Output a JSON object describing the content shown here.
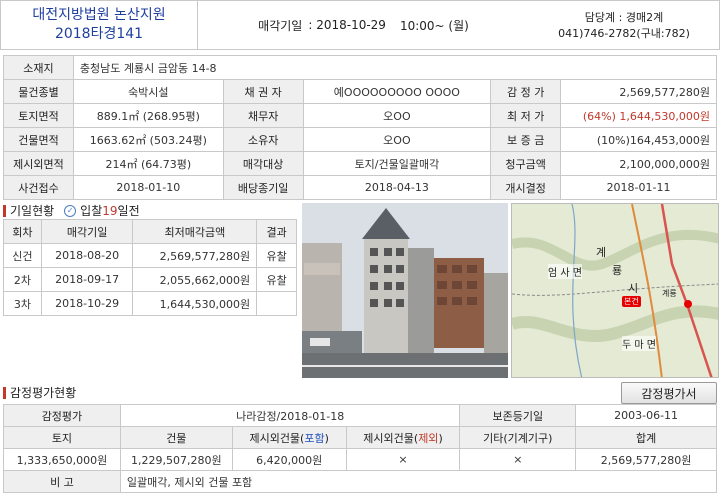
{
  "header": {
    "court": "대전지방법원 논산지원",
    "case_no": "2018타경141",
    "auction_label": "매각기일",
    "auction_date": ": 2018-10-29",
    "auction_time": "10:00~ (월)",
    "contact_dept": "담당계 : 경매2계",
    "contact_phone": "041)746-2782(구내:782)"
  },
  "info": {
    "address_label": "소재지",
    "address": "충청남도 계룡시 금암동 14-8",
    "rows": [
      [
        "물건종별",
        "숙박시설",
        "채 권 자",
        "예OOOOOOOOO OOOO",
        "감 정 가",
        "2,569,577,280원"
      ],
      [
        "토지면적",
        "889.1㎡ (268.95평)",
        "채무자",
        "오OO",
        "최 저 가",
        "(64%) 1,644,530,000원"
      ],
      [
        "건물면적",
        "1663.62㎡ (503.24평)",
        "소유자",
        "오OO",
        "보 증 금",
        "(10%)164,453,000원"
      ],
      [
        "제시외면적",
        "214㎡ (64.73평)",
        "매각대상",
        "토지/건물일괄매각",
        "청구금액",
        "2,100,000,000원"
      ],
      [
        "사건접수",
        "2018-01-10",
        "배당종기일",
        "2018-04-13",
        "개시결정",
        "2018-01-11"
      ]
    ]
  },
  "history": {
    "title": "기일현황",
    "badge_prefix": "입찰",
    "badge_days": "19",
    "badge_suffix": "일전",
    "headers": [
      "회차",
      "매각기일",
      "최저매각금액",
      "결과"
    ],
    "rows": [
      [
        "신건",
        "2018-08-20",
        "2,569,577,280원",
        "유찰"
      ],
      [
        "2차",
        "2018-09-17",
        "2,055,662,000원",
        "유찰"
      ],
      [
        "3차",
        "2018-10-29",
        "1,644,530,000원",
        ""
      ]
    ]
  },
  "map": {
    "labels": [
      "계",
      "룡",
      "시",
      "엄 사 면",
      "두 마 면",
      "계룡"
    ],
    "marker_label": "본건"
  },
  "appraisal": {
    "title": "감정평가현황",
    "button": "감정평가서",
    "row1": [
      "감정평가",
      "나라감정/2018-01-18",
      "보존등기일",
      "2003-06-11"
    ],
    "headers": [
      "토지",
      "건물",
      "제시외건물(",
      "포함",
      ")",
      "제시외건물(",
      "제외",
      ")",
      "기타(기계기구)",
      "합계"
    ],
    "values": [
      "1,333,650,000원",
      "1,229,507,280원",
      "6,420,000원",
      "×",
      "×",
      "2,569,577,280원"
    ],
    "note_label": "비 고",
    "note": "일괄매각, 제시외 건물 포함"
  }
}
